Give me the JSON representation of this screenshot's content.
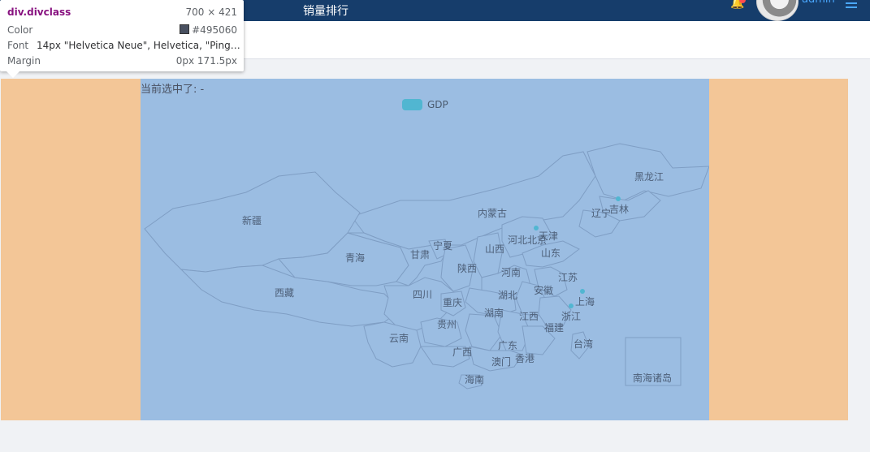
{
  "navbar": {
    "title": "销量排行",
    "username": "admin",
    "icons": [
      "bell-icon",
      "menu-icon"
    ]
  },
  "devtools_tip": {
    "element": "div.divclass",
    "size": "700 × 421",
    "color_label": "Color",
    "color_value": "#495060",
    "font_label": "Font",
    "font_value": "14px \"Helvetica Neue\", Helvetica, \"PingFa...",
    "margin_label": "Margin",
    "margin_value": "0px 171.5px"
  },
  "map": {
    "selected_text": "当前选中了: -",
    "legend": "GDP",
    "regions": [
      "黑龙江",
      "吉林",
      "辽宁",
      "内蒙古",
      "新疆",
      "青海",
      "甘肃",
      "宁夏",
      "陕西",
      "山西",
      "河北",
      "北京",
      "天津",
      "山东",
      "河南",
      "江苏",
      "安徽",
      "湖北",
      "四川",
      "重庆",
      "西藏",
      "贵州",
      "湖南",
      "江西",
      "浙江",
      "上海",
      "福建",
      "台湾",
      "云南",
      "广西",
      "广东",
      "澳门",
      "香港",
      "海南",
      "南海诸岛"
    ]
  },
  "colors": {
    "navbar": "#163d6b",
    "map_bg": "#9bbde2",
    "side_bg": "#f3c697",
    "legend": "#51b6d1",
    "accent": "#4aa8ff"
  }
}
